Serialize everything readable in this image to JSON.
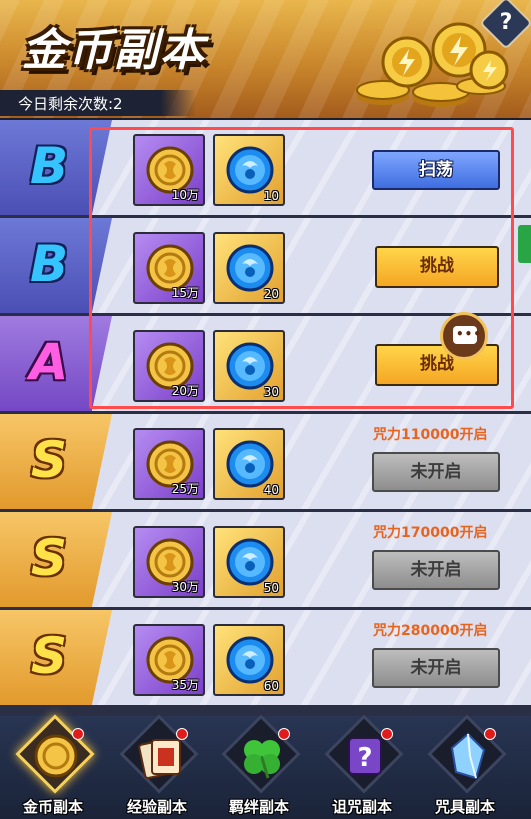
{
  "header": {
    "title": "金币副本",
    "help_icon": "question-icon",
    "help_label": "?",
    "remaining_label": "今日剩余次数:2"
  },
  "rows": [
    {
      "grade": "B",
      "coin_qty": "10万",
      "gem_qty": "10",
      "action_label": "扫荡",
      "action_type": "sweep"
    },
    {
      "grade": "B",
      "coin_qty": "15万",
      "gem_qty": "20",
      "action_label": "挑战",
      "action_type": "challenge"
    },
    {
      "grade": "A",
      "coin_qty": "20万",
      "gem_qty": "30",
      "action_label": "挑战",
      "action_type": "challenge"
    },
    {
      "grade": "S",
      "coin_qty": "25万",
      "gem_qty": "40",
      "requirement": "咒力110000开启",
      "action_label": "未开启",
      "action_type": "locked"
    },
    {
      "grade": "S",
      "coin_qty": "30万",
      "gem_qty": "50",
      "requirement": "咒力170000开启",
      "action_label": "未开启",
      "action_type": "locked"
    },
    {
      "grade": "S",
      "coin_qty": "35万",
      "gem_qty": "60",
      "requirement": "咒力280000开启",
      "action_label": "未开启",
      "action_type": "locked"
    }
  ],
  "chat_icon": "chat-bubble-icon",
  "nav": {
    "items": [
      {
        "label": "金币副本",
        "icon": "gold-coin-icon",
        "active": true,
        "badge": true
      },
      {
        "label": "经验副本",
        "icon": "exp-card-icon",
        "active": false,
        "badge": true
      },
      {
        "label": "羁绊副本",
        "icon": "clover-icon",
        "active": false,
        "badge": true
      },
      {
        "label": "诅咒副本",
        "icon": "curse-icon",
        "active": false,
        "badge": true
      },
      {
        "label": "咒具副本",
        "icon": "crystal-icon",
        "active": false,
        "badge": true
      }
    ]
  },
  "colors": {
    "highlight": "#ff4b4b",
    "requirement_text": "#e8641e",
    "sweep_button": "#3f6ee0",
    "challenge_button": "#f5a623",
    "locked_button": "#8d8d8d"
  }
}
